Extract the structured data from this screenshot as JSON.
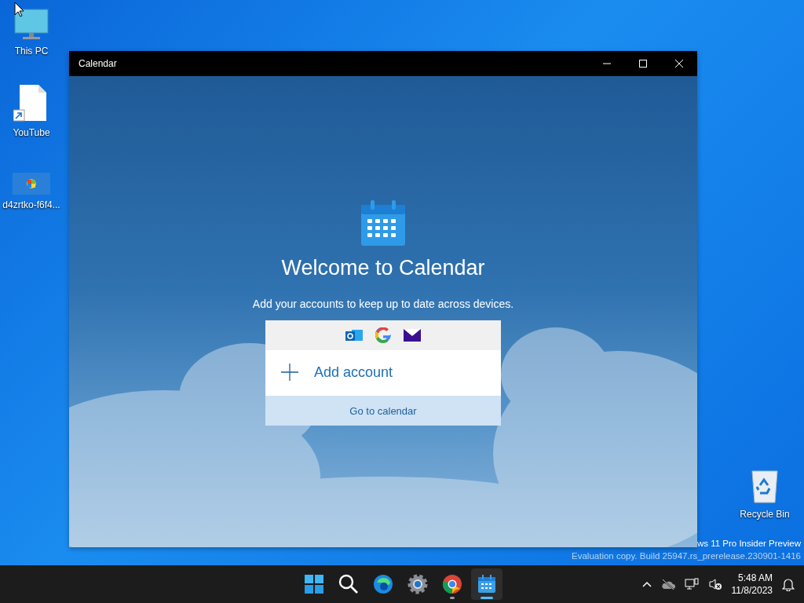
{
  "desktop_icons": [
    {
      "kind": "pc",
      "label": "This PC"
    },
    {
      "kind": "file",
      "label": "YouTube"
    },
    {
      "kind": "image",
      "label": "d4zrtko-f6f4..."
    },
    {
      "kind": "recycle",
      "label": "Recycle Bin"
    }
  ],
  "window": {
    "title": "Calendar",
    "heading": "Welcome to Calendar",
    "subtitle": "Add your accounts to keep up to date across devices.",
    "add_account": "Add account",
    "go_to_calendar": "Go to calendar"
  },
  "watermark": {
    "line_1": "ws 11 Pro Insider Preview",
    "line_2": "Evaluation copy. Build 25947.rs_prerelease.230901-1416"
  },
  "taskbar": {
    "apps": [
      {
        "kind": "start",
        "selected": false,
        "running": false
      },
      {
        "kind": "search",
        "selected": false,
        "running": false
      },
      {
        "kind": "edge",
        "selected": false,
        "running": false
      },
      {
        "kind": "settings",
        "selected": false,
        "running": false
      },
      {
        "kind": "chrome",
        "selected": false,
        "running": true
      },
      {
        "kind": "calendar",
        "selected": true,
        "running": true
      }
    ],
    "time": "5:48 AM",
    "date": "11/8/2023"
  }
}
